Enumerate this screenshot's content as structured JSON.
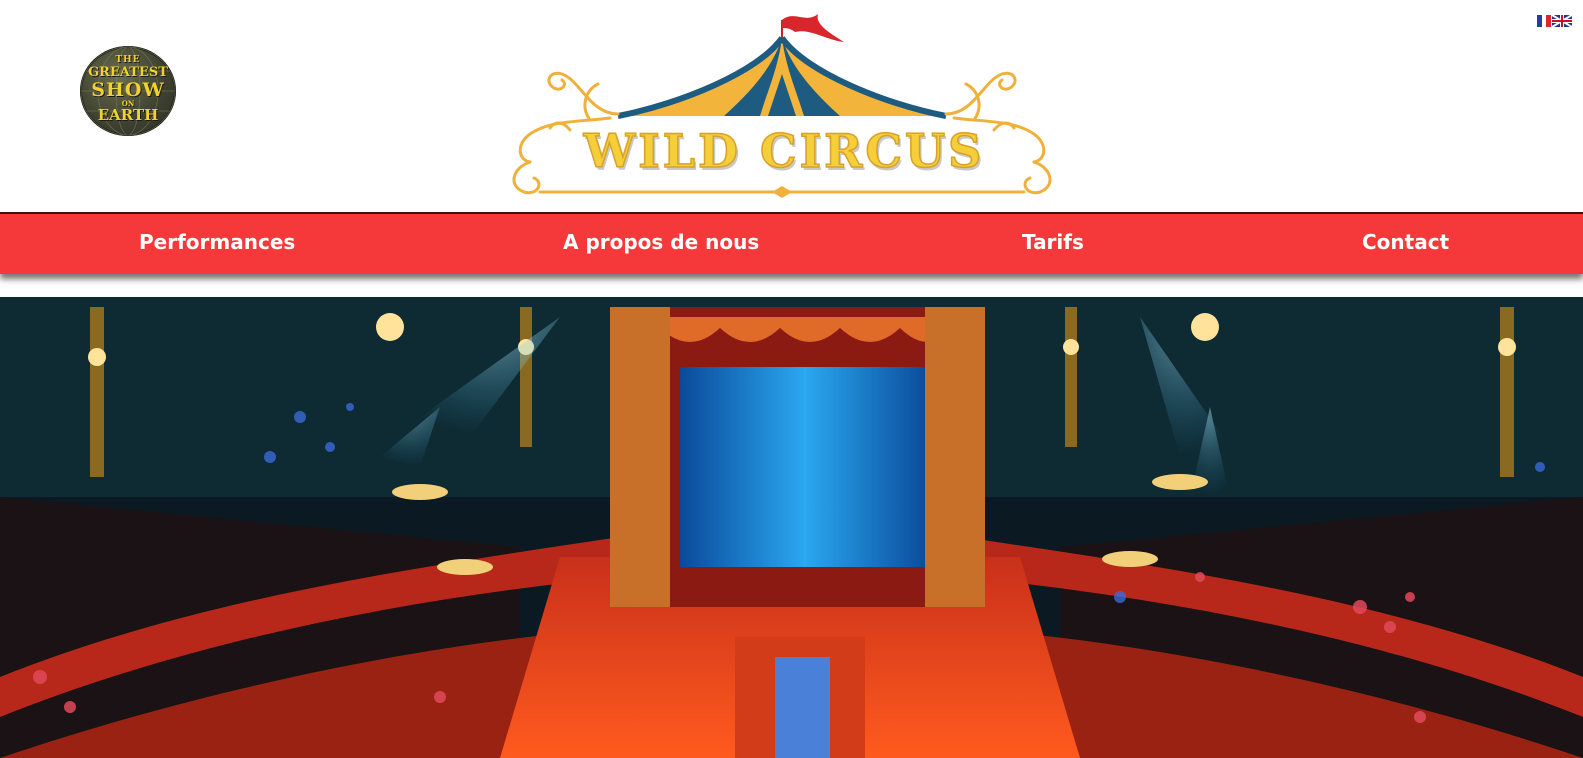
{
  "header": {
    "badge": {
      "line1": "THE",
      "line2": "GREATEST",
      "line3": "SHOW",
      "line4": "ON",
      "line5": "EARTH"
    },
    "logo": {
      "title": "WILD CIRCUS"
    },
    "languages": [
      {
        "code": "fr",
        "icon": "french-flag-icon"
      },
      {
        "code": "en",
        "icon": "uk-flag-icon"
      }
    ]
  },
  "nav": {
    "items": [
      {
        "label": "Performances"
      },
      {
        "label": "A propos de nous"
      },
      {
        "label": "Tarifs"
      },
      {
        "label": "Contact"
      }
    ]
  },
  "colors": {
    "nav_background": "#f5393b",
    "nav_text": "#ffffff",
    "logo_gold": "#f4cf3a",
    "tent_blue": "#1e5b80",
    "tent_yellow": "#f2b43a"
  },
  "hero": {
    "image": "circus-arena-photo"
  }
}
